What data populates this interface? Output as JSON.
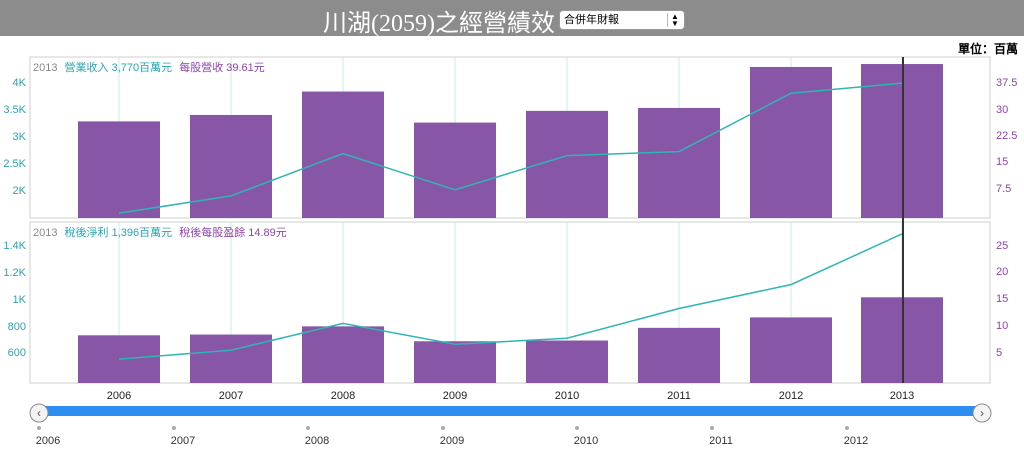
{
  "header": {
    "title": "川湖(2059)之經營績效",
    "select_value": "合併年財報",
    "unit": "單位：百萬"
  },
  "colors": {
    "bar": "#8856a7",
    "line": "#2fb5b5",
    "left_axis": "#27a5b3",
    "right_axis": "#8e44ad",
    "cursor": "#333333",
    "slider": "#2b8ef0"
  },
  "chart_data": [
    {
      "type": "bar",
      "legend": {
        "year": "2013",
        "bar_label": "營業收入 3,770百萬元",
        "line_label": "每股營收 39.61元"
      },
      "categories": [
        "2006",
        "2007",
        "2008",
        "2009",
        "2010",
        "2011",
        "2012",
        "2013"
      ],
      "series": [
        {
          "name": "營業收入",
          "type": "bar",
          "axis": "left",
          "values": [
            3150,
            3260,
            3660,
            3130,
            3330,
            3380,
            4080,
            4130
          ]
        },
        {
          "name": "每股營收",
          "type": "line",
          "axis": "right",
          "values": [
            1.2,
            5.5,
            16,
            7,
            15.5,
            16.5,
            31,
            33.5
          ]
        }
      ],
      "left_ticks": [
        "2K",
        "2.5K",
        "3K",
        "3.5K",
        "4K"
      ],
      "right_ticks": [
        "7.5",
        "15",
        "22.5",
        "30",
        "37.5"
      ],
      "ylim_left": [
        1500,
        4250
      ],
      "ylim_right": [
        0,
        40
      ]
    },
    {
      "type": "bar",
      "legend": {
        "year": "2013",
        "bar_label": "稅後淨利 1,396百萬元",
        "line_label": "稅後每股盈餘 14.89元"
      },
      "categories": [
        "2006",
        "2007",
        "2008",
        "2009",
        "2010",
        "2011",
        "2012",
        "2013"
      ],
      "series": [
        {
          "name": "稅後淨利",
          "type": "bar",
          "axis": "left",
          "values": [
            740,
            745,
            800,
            700,
            705,
            790,
            860,
            995
          ]
        },
        {
          "name": "稅後每股盈餘",
          "type": "line",
          "axis": "right",
          "values": [
            4,
            5.5,
            10,
            6.5,
            7.5,
            12.5,
            16.5,
            25
          ]
        }
      ],
      "left_ticks": [
        "600",
        "800",
        "1K",
        "1.2K",
        "1.4K"
      ],
      "right_ticks": [
        "5",
        "10",
        "15",
        "20",
        "25"
      ],
      "ylim_left": [
        420,
        1500
      ],
      "ylim_right": [
        0,
        27
      ]
    }
  ],
  "navigator": {
    "labels": [
      "2006",
      "2007",
      "2008",
      "2009",
      "2010",
      "2011",
      "2012"
    ]
  }
}
